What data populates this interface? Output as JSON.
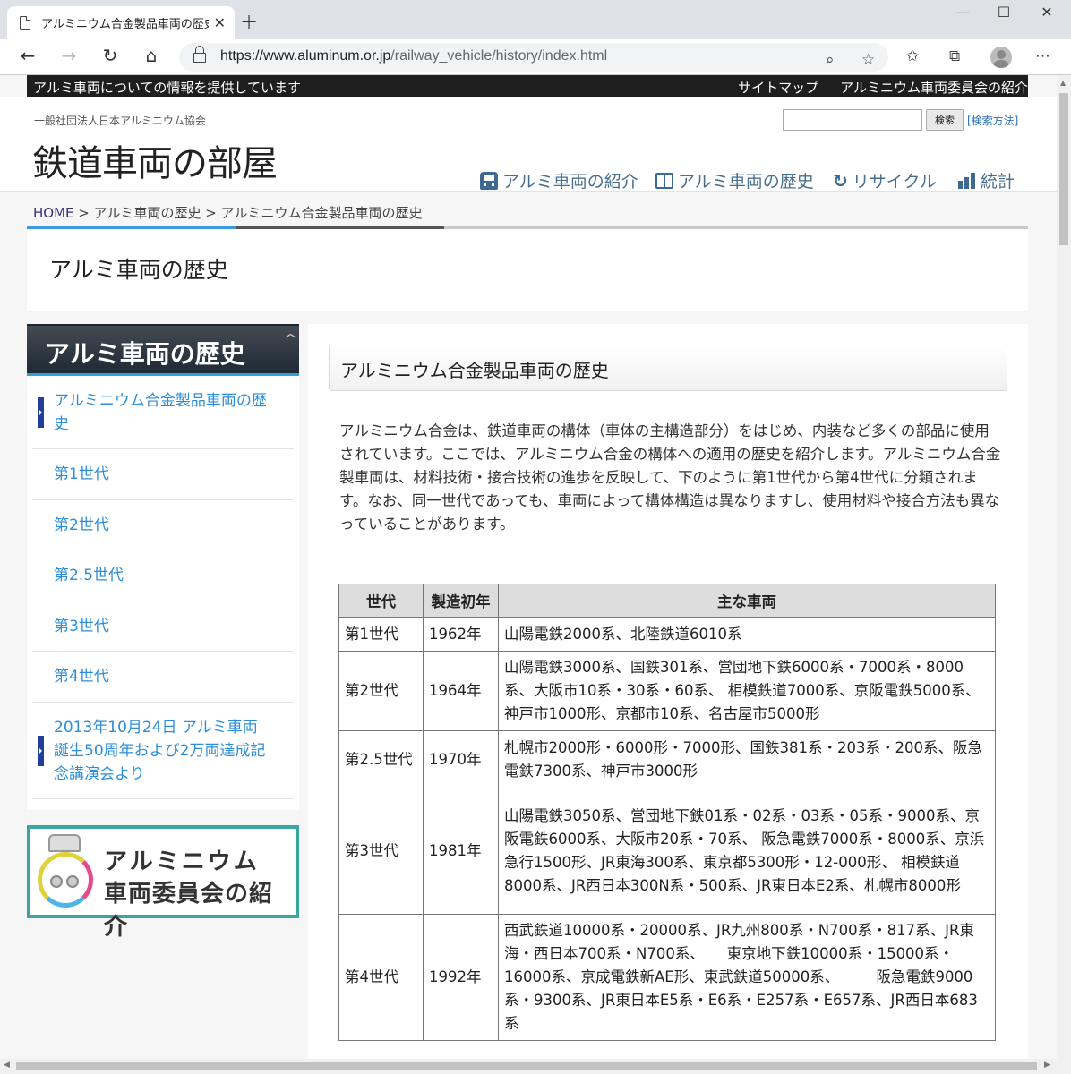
{
  "browser": {
    "tab_title": "アルミニウム合金製品車両の歴史 | ア",
    "url_host": "https://www.aluminum.or.jp",
    "url_path": "/railway_vehicle/history/index.html"
  },
  "topstrip": {
    "tagline": "アルミ車両についての情報を提供しています",
    "links": [
      "サイトマップ",
      "アルミニウム車両委員会の紹介"
    ]
  },
  "header": {
    "org": "一般社団法人日本アルミニウム協会",
    "site_title": "鉄道車両の部屋",
    "search_button": "検索",
    "search_help": "[検索方法]",
    "nav": [
      "アルミ車両の紹介",
      "アルミ車両の歴史",
      "リサイクル",
      "統計"
    ]
  },
  "breadcrumb": {
    "home": "HOME",
    "sep": " > ",
    "items": [
      "アルミ車両の歴史",
      "アルミニウム合金製品車両の歴史"
    ]
  },
  "page_title": "アルミ車両の歴史",
  "sidebar": {
    "heading": "アルミ車両の歴史",
    "items": [
      "アルミニウム合金製品車両の歴史",
      "第1世代",
      "第2世代",
      "第2.5世代",
      "第3世代",
      "第4世代",
      "2013年10月24日 アルミ車両誕生50周年および2万両達成記念講演会より"
    ],
    "banner_line1": "アルミニウム",
    "banner_line2": "車両委員会の紹介"
  },
  "main": {
    "section_title": "アルミニウム合金製品車両の歴史",
    "intro": "アルミニウム合金は、鉄道車両の構体（車体の主構造部分）をはじめ、内装など多くの部品に使用されています。ここでは、アルミニウム合金の構体への適用の歴史を紹介します。アルミニウム合金製車両は、材料技術・接合技術の進歩を反映して、下のように第1世代から第4世代に分類されます。なお、同一世代であっても、車両によって構体構造は異なりますし、使用材料や接合方法も異なっていることがあります。",
    "table": {
      "headers": [
        "世代",
        "製造初年",
        "主な車両"
      ],
      "rows": [
        {
          "gen": "第1世代",
          "year": "1962年",
          "vehicles": "山陽電鉄2000系、北陸鉄道6010系"
        },
        {
          "gen": "第2世代",
          "year": "1964年",
          "vehicles": "山陽電鉄3000系、国鉄301系、営団地下鉄6000系・7000系・8000系、大阪市10系・30系・60系、 相模鉄道7000系、京阪電鉄5000系、神戸市1000形、京都市10系、名古屋市5000形"
        },
        {
          "gen": "第2.5世代",
          "year": "1970年",
          "vehicles": "札幌市2000形・6000形・7000形、国鉄381系・203系・200系、阪急電鉄7300系、神戸市3000形"
        },
        {
          "gen": "第3世代",
          "year": "1981年",
          "vehicles": "山陽電鉄3050系、営団地下鉄01系・02系・03系・05系・9000系、京阪電鉄6000系、大阪市20系・70系、 阪急電鉄7000系・8000系、京浜急行1500形、JR東海300系、東京都5300形・12-000形、 相模鉄道8000系、JR西日本300N系・500系、JR東日本E2系、札幌市8000形"
        },
        {
          "gen": "第4世代",
          "year": "1992年",
          "vehicles": "西武鉄道10000系・20000系、JR九州800系・N700系・817系、JR東海・西日本700系・N700系、　　東京地下鉄10000系・15000系・16000系、京成電鉄新AE形、東武鉄道50000系、　　　阪急電鉄9000系・9300系、JR東日本E5系・E6系・E257系・E657系、JR西日本683系"
        }
      ]
    }
  },
  "icons": {
    "back": "arrow-left-icon",
    "forward": "arrow-right-icon",
    "reload": "reload-icon",
    "home": "home-icon",
    "lock": "lock-icon",
    "zoom": "zoom-icon",
    "star": "star-icon"
  }
}
